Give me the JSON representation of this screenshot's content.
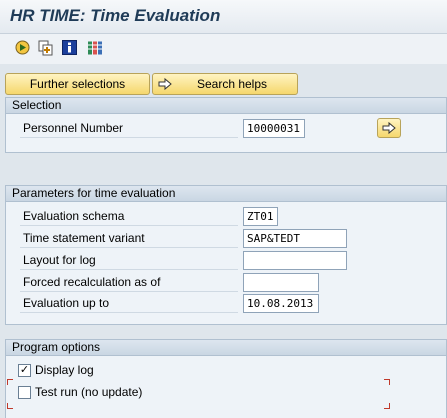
{
  "title": "HR TIME: Time Evaluation",
  "toolbar": {
    "icons": [
      "execute-icon",
      "variant-icon",
      "info-icon",
      "layout-icon"
    ]
  },
  "buttons": {
    "further_selections": "Further selections",
    "search_helps": "Search helps"
  },
  "selection": {
    "header": "Selection",
    "personnel_number_label": "Personnel Number",
    "personnel_number_value": "10000031"
  },
  "parameters": {
    "header": "Parameters for time evaluation",
    "evaluation_schema_label": "Evaluation schema",
    "evaluation_schema_value": "ZT01",
    "time_statement_variant_label": "Time statement variant",
    "time_statement_variant_value": "SAP&TEDT",
    "layout_for_log_label": "Layout for log",
    "layout_for_log_value": "",
    "forced_recalc_label": "Forced recalculation as of",
    "forced_recalc_value": "",
    "evaluation_up_to_label": "Evaluation up to",
    "evaluation_up_to_value": "10.08.2013"
  },
  "program_options": {
    "header": "Program options",
    "display_log_label": "Display log",
    "display_log_checked": true,
    "test_run_label": "Test run (no update)",
    "test_run_checked": false
  },
  "colors": {
    "title_text": "#1f3b57",
    "button_fill": "#f5d76d",
    "group_header": "#c9d6e3",
    "background": "#dfe6ec",
    "corner_marker": "#c0392b"
  }
}
